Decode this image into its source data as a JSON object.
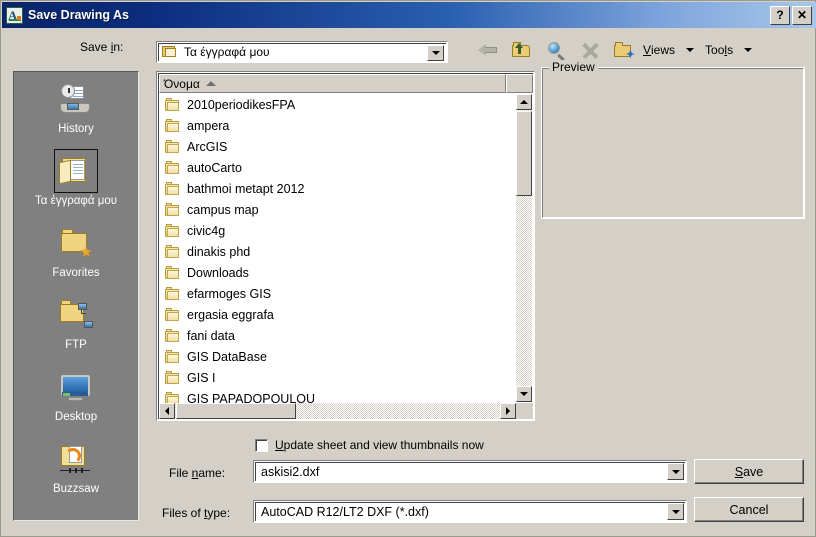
{
  "window": {
    "title": "Save Drawing As",
    "app_icon": "autocad-icon",
    "help_label": "?",
    "close_label": "✕"
  },
  "saveIn": {
    "label_pre": "Save ",
    "label_accel": "i",
    "label_post": "n:",
    "value": "Τα έγγραφά μου",
    "icon": "folder-open-icon"
  },
  "toolbar": {
    "icons": [
      {
        "name": "back-icon",
        "tooltip": "Back"
      },
      {
        "name": "up-one-level-icon",
        "tooltip": "Up one level"
      },
      {
        "name": "search-web-icon",
        "tooltip": "Search the Web"
      },
      {
        "name": "delete-icon",
        "tooltip": "Delete"
      },
      {
        "name": "new-folder-icon",
        "tooltip": "Create New Folder"
      }
    ],
    "views": {
      "pre": "",
      "accel": "V",
      "post": "iews"
    },
    "tools": {
      "pre": "Too",
      "accel": "l",
      "post": "s"
    }
  },
  "places": [
    {
      "label": "History",
      "icon": "history-icon",
      "selected": false
    },
    {
      "label": "Τα έγγραφά μου",
      "icon": "my-documents-icon",
      "selected": true
    },
    {
      "label": "Favorites",
      "icon": "favorites-icon",
      "selected": false
    },
    {
      "label": "FTP",
      "icon": "ftp-icon",
      "selected": false
    },
    {
      "label": "Desktop",
      "icon": "desktop-icon",
      "selected": false
    },
    {
      "label": "Buzzsaw",
      "icon": "buzzsaw-icon",
      "selected": false
    }
  ],
  "fileList": {
    "column_header": "Όνομα",
    "sort_direction": "ascending",
    "items": [
      {
        "name": "2010periodikesFPA",
        "icon": "folder-icon"
      },
      {
        "name": "ampera",
        "icon": "folder-icon"
      },
      {
        "name": "ArcGIS",
        "icon": "folder-icon"
      },
      {
        "name": "autoCarto",
        "icon": "folder-icon"
      },
      {
        "name": "bathmoi metapt 2012",
        "icon": "folder-icon"
      },
      {
        "name": "campus map",
        "icon": "folder-icon"
      },
      {
        "name": "civic4g",
        "icon": "folder-icon"
      },
      {
        "name": "dinakis phd",
        "icon": "folder-icon"
      },
      {
        "name": "Downloads",
        "icon": "folder-icon"
      },
      {
        "name": "efarmoges GIS",
        "icon": "folder-icon"
      },
      {
        "name": "ergasia eggrafa",
        "icon": "folder-icon"
      },
      {
        "name": "fani data",
        "icon": "folder-icon"
      },
      {
        "name": "GIS DataBase",
        "icon": "folder-icon"
      },
      {
        "name": "GIS I",
        "icon": "folder-icon"
      },
      {
        "name": "GIS PAPADOPOULOU",
        "icon": "folder-icon"
      }
    ]
  },
  "preview": {
    "label": "Preview",
    "content": ""
  },
  "form": {
    "thumbnail_checkbox": {
      "checked": false,
      "label_pre": "",
      "label_accel": "U",
      "label_post": "pdate sheet and view thumbnails now"
    },
    "file_name": {
      "label_pre": "File ",
      "label_accel": "n",
      "label_post": "ame:",
      "value": "askisi2.dxf"
    },
    "files_of_type": {
      "label_pre": "Files of ",
      "label_accel": "t",
      "label_post": "ype:",
      "value": "AutoCAD R12/LT2 DXF (*.dxf)"
    }
  },
  "buttons": {
    "save": {
      "pre": "",
      "accel": "S",
      "post": "ave"
    },
    "cancel": {
      "pre": "Cancel",
      "accel": "",
      "post": ""
    }
  },
  "colors": {
    "title_start": "#0a246a",
    "title_end": "#a8c6ea",
    "dialog_face": "#d4d0c8",
    "places_bar": "#808080",
    "list_background": "#ffffff"
  }
}
